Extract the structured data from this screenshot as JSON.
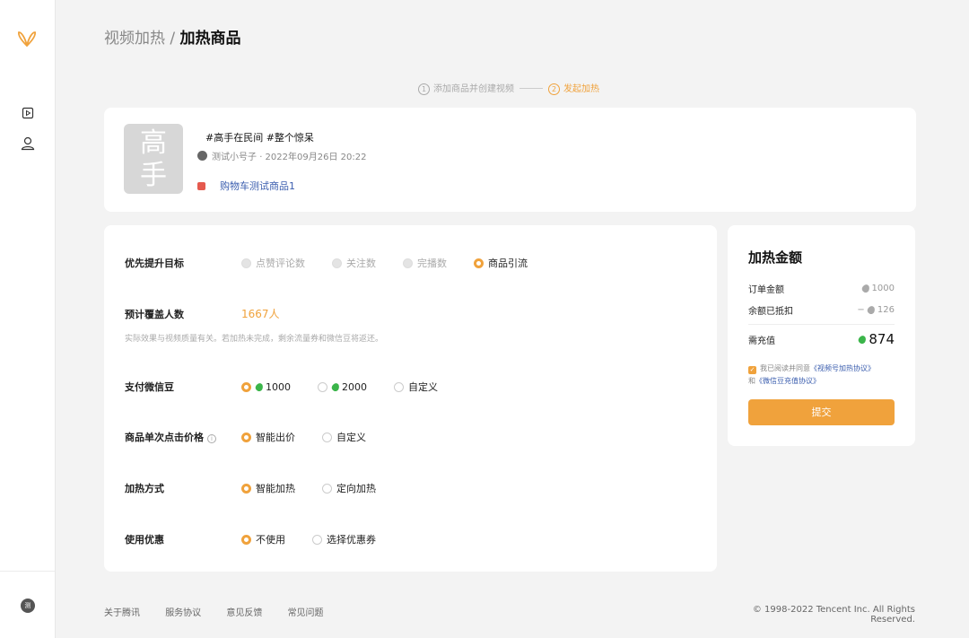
{
  "breadcrumb": {
    "parent": "视频加热",
    "sep": " / ",
    "current": "加热商品"
  },
  "steps": [
    {
      "num": "1",
      "label": "添加商品并创建视频"
    },
    {
      "num": "2",
      "label": "发起加热"
    }
  ],
  "video": {
    "thumb_text_1": "高",
    "thumb_text_2": "手",
    "title": "#高手在民间 #整个惊呆",
    "author": "测试小号子",
    "time": "· 2022年09月26日 20:22",
    "product": "购物车测试商品1"
  },
  "form": {
    "goal_label": "优先提升目标",
    "goal_options": [
      "点赞评论数",
      "关注数",
      "完播数",
      "商品引流"
    ],
    "cover_label": "预计覆盖人数",
    "cover_value": "1667人",
    "note": "实际效果与视频质量有关。若加热未完成，剩余流量券和微信豆将返还。",
    "pay_label": "支付微信豆",
    "pay_options": [
      "1000",
      "2000",
      "自定义"
    ],
    "price_label": "商品单次点击价格",
    "price_info_icon": "i",
    "price_options": [
      "智能出价",
      "自定义"
    ],
    "method_label": "加热方式",
    "method_options": [
      "智能加热",
      "定向加热"
    ],
    "coupon_label": "使用优惠",
    "coupon_options": [
      "不使用",
      "选择优惠券"
    ]
  },
  "payment": {
    "title": "加热金额",
    "order_label": "订单金额",
    "order_value": "1000",
    "balance_label": "余额已抵扣",
    "balance_prefix": "−",
    "balance_value": "126",
    "need_label": "需充值",
    "need_value": "874",
    "agree_prefix": "我已阅读并同意",
    "agree_link1": "《视频号加热协议》",
    "agree_and": "和",
    "agree_link2": "《微信豆充值协议》",
    "submit": "提交"
  },
  "sidebar": {
    "avatar_text": "测"
  },
  "footer": {
    "links": [
      "关于腾讯",
      "服务协议",
      "意见反馈",
      "常见问题"
    ],
    "copyright": "© 1998-2022 Tencent Inc. All Rights Reserved."
  },
  "colors": {
    "accent": "#f0a23c",
    "link": "#3a5dae",
    "coin": "#3bb54a"
  }
}
